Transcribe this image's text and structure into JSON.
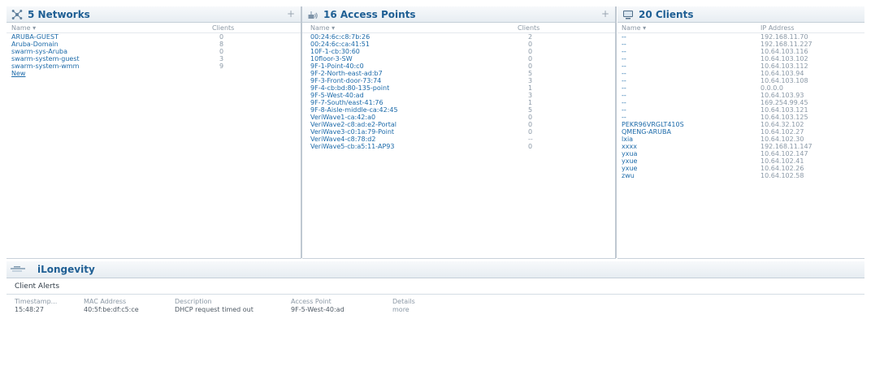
{
  "networks": {
    "title": "5 Networks",
    "plus": "+",
    "col_name": "Name ▾",
    "col_clients": "Clients",
    "items": [
      {
        "name": "ARUBA-GUEST",
        "clients": "0"
      },
      {
        "name": "Aruba-Domain",
        "clients": "8"
      },
      {
        "name": "swarm-sys-Aruba",
        "clients": "0"
      },
      {
        "name": "swarm-system-guest",
        "clients": "3"
      },
      {
        "name": "swarm-system-wmm",
        "clients": "9"
      }
    ],
    "new_label": "New"
  },
  "access_points": {
    "title": "16 Access Points",
    "plus": "+",
    "col_name": "Name ▾",
    "col_clients": "Clients",
    "items": [
      {
        "name": "00:24:6c:c8:7b:26",
        "clients": "2"
      },
      {
        "name": "00:24:6c:ca:41:51",
        "clients": "0"
      },
      {
        "name": "10F-1-cb:30:60",
        "clients": "0"
      },
      {
        "name": "10floor-3-SW",
        "clients": "0"
      },
      {
        "name": "9F-1-Point-40:c0",
        "clients": "0"
      },
      {
        "name": "9F-2-North-east-ad:b7",
        "clients": "5"
      },
      {
        "name": "9F-3-Front-door-73:74",
        "clients": "3"
      },
      {
        "name": "9F-4-cb:bd:80-135-point",
        "clients": "1"
      },
      {
        "name": "9F-5-West-40:ad",
        "clients": "3"
      },
      {
        "name": "9F-7-South/east-41:76",
        "clients": "1"
      },
      {
        "name": "9F-8-Aisle-middle-ca:42:45",
        "clients": "5"
      },
      {
        "name": "VeriWave1-ca:42:a0",
        "clients": "0"
      },
      {
        "name": "VeriWave2-c8:ad:e2-Portal",
        "clients": "0"
      },
      {
        "name": "VeriWave3-c0:1a:79-Point",
        "clients": "0"
      },
      {
        "name": "VeriWave4-c8:78:d2",
        "clients": "--"
      },
      {
        "name": "VeriWave5-cb:a5:11-AP93",
        "clients": "0"
      }
    ]
  },
  "clients": {
    "title": "20 Clients",
    "col_name": "Name ▾",
    "col_ip": "IP Address",
    "items": [
      {
        "name": "--",
        "ip": "192.168.11.70"
      },
      {
        "name": "--",
        "ip": "192.168.11.227"
      },
      {
        "name": "--",
        "ip": "10.64.103.116"
      },
      {
        "name": "--",
        "ip": "10.64.103.102"
      },
      {
        "name": "--",
        "ip": "10.64.103.112"
      },
      {
        "name": "--",
        "ip": "10.64.103.94"
      },
      {
        "name": "--",
        "ip": "10.64.103.108"
      },
      {
        "name": "--",
        "ip": "0.0.0.0"
      },
      {
        "name": "--",
        "ip": "10.64.103.93"
      },
      {
        "name": "--",
        "ip": "169.254.99.45"
      },
      {
        "name": "--",
        "ip": "10.64.103.121"
      },
      {
        "name": "--",
        "ip": "10.64.103.125"
      },
      {
        "name": "PEKR96VRGLT410S",
        "ip": "10.64.32.102"
      },
      {
        "name": "QMENG-ARUBA",
        "ip": "10.64.102.27"
      },
      {
        "name": "lxia",
        "ip": "10.64.102.30"
      },
      {
        "name": "xxxx",
        "ip": "192.168.11.147"
      },
      {
        "name": "yxua",
        "ip": "10.64.102.147"
      },
      {
        "name": "yxue",
        "ip": "10.64.102.41"
      },
      {
        "name": "yxue",
        "ip": "10.64.102.26"
      },
      {
        "name": "zwu",
        "ip": "10.64.102.58"
      }
    ]
  },
  "longevity": {
    "title": "iLongevity",
    "section_label": "Client Alerts",
    "columns": [
      "Timestamp...",
      "MAC Address",
      "Description",
      "Access Point",
      "Details"
    ],
    "rows": [
      {
        "timestamp": "15:48:27",
        "mac": "40:5f:be:df:c5:ce",
        "description": "DHCP request timed out",
        "access_point": "9F-5-West-40:ad",
        "details": "more"
      }
    ]
  },
  "colors": {
    "accent": "#1c6aa9",
    "header_text": "#1f5f94",
    "muted": "#8a98a6"
  }
}
